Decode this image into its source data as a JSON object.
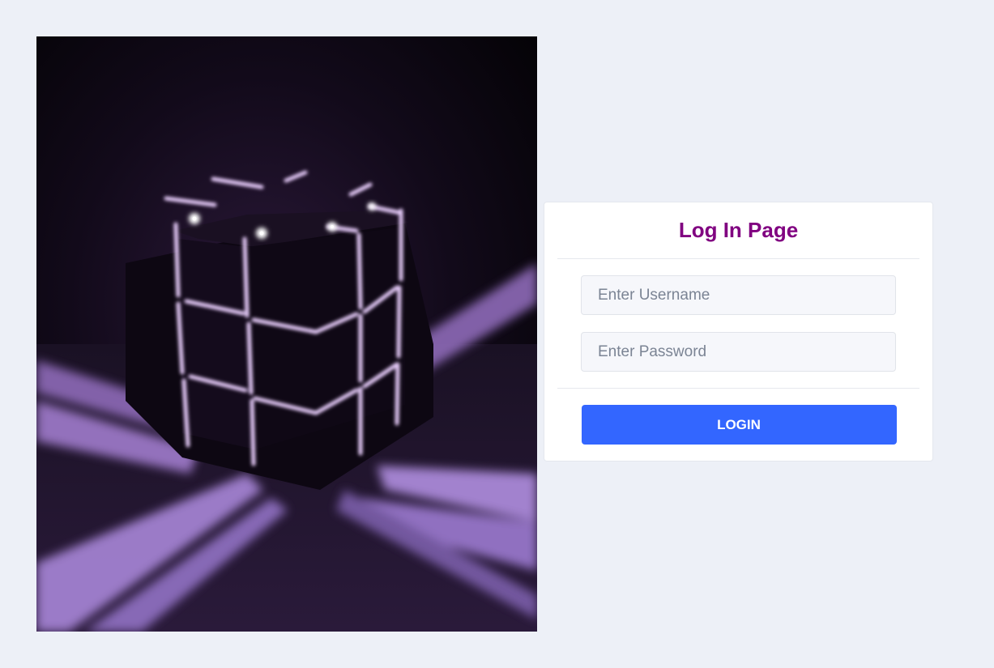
{
  "hero": {
    "image_name": "glowing-purple-cube-image"
  },
  "login": {
    "title": "Log In Page",
    "username_placeholder": "Enter Username",
    "password_placeholder": "Enter Password",
    "button_label": "LOGIN"
  },
  "colors": {
    "page_background": "#edf0f7",
    "title": "#800080",
    "button": "#3366ff",
    "glow": "#c9a3f5"
  }
}
